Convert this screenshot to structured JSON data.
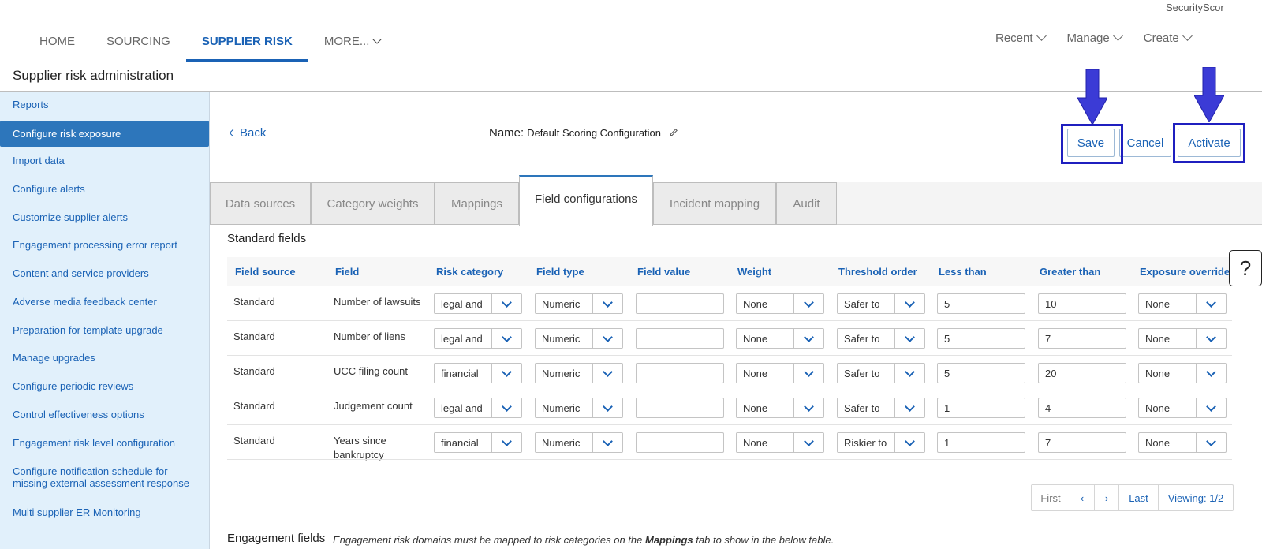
{
  "user": {
    "name": "SecurityScor"
  },
  "topnav": {
    "items": [
      {
        "label": "HOME"
      },
      {
        "label": "SOURCING"
      },
      {
        "label": "SUPPLIER RISK",
        "active": true
      },
      {
        "label": "MORE..."
      }
    ],
    "right": [
      {
        "label": "Recent"
      },
      {
        "label": "Manage"
      },
      {
        "label": "Create"
      }
    ]
  },
  "page": {
    "title": "Supplier risk administration"
  },
  "sidebar": {
    "items": [
      {
        "label": "Reports"
      },
      {
        "label": "Configure risk exposure",
        "active": true
      },
      {
        "label": "Import data"
      },
      {
        "label": "Configure alerts"
      },
      {
        "label": "Customize supplier alerts"
      },
      {
        "label": "Engagement processing error report"
      },
      {
        "label": "Content and service providers"
      },
      {
        "label": "Adverse media feedback center"
      },
      {
        "label": "Preparation for template upgrade"
      },
      {
        "label": "Manage upgrades"
      },
      {
        "label": "Configure periodic reviews"
      },
      {
        "label": "Control effectiveness options"
      },
      {
        "label": "Engagement risk level configuration"
      },
      {
        "label": "Configure notification schedule for missing external assessment response"
      },
      {
        "label": "Multi supplier ER Monitoring"
      }
    ]
  },
  "config": {
    "back_label": "Back",
    "name_label": "Name:",
    "name_value": "Default Scoring Configuration",
    "save_label": "Save",
    "cancel_label": "Cancel",
    "activate_label": "Activate",
    "highlight_color": "#1f1fbf",
    "accent_color": "#1a62b5"
  },
  "tabs": [
    {
      "label": "Data sources"
    },
    {
      "label": "Category weights"
    },
    {
      "label": "Mappings"
    },
    {
      "label": "Field configurations",
      "active": true
    },
    {
      "label": "Incident mapping"
    },
    {
      "label": "Audit"
    }
  ],
  "standard_fields": {
    "title": "Standard fields",
    "columns": [
      "Field source",
      "Field",
      "Risk category",
      "Field type",
      "Field value",
      "Weight",
      "Threshold order",
      "Less than",
      "Greater than",
      "Exposure override"
    ],
    "rows": [
      {
        "source": "Standard",
        "field": "Number of lawsuits",
        "risk_category": "legal and",
        "field_type": "Numeric",
        "field_value": "",
        "weight": "None",
        "threshold": "Safer to",
        "less_than": "5",
        "greater_than": "10",
        "override": "None"
      },
      {
        "source": "Standard",
        "field": "Number of liens",
        "risk_category": "legal and",
        "field_type": "Numeric",
        "field_value": "",
        "weight": "None",
        "threshold": "Safer to",
        "less_than": "5",
        "greater_than": "7",
        "override": "None"
      },
      {
        "source": "Standard",
        "field": "UCC filing count",
        "risk_category": "financial",
        "field_type": "Numeric",
        "field_value": "",
        "weight": "None",
        "threshold": "Safer to",
        "less_than": "5",
        "greater_than": "20",
        "override": "None"
      },
      {
        "source": "Standard",
        "field": "Judgement count",
        "risk_category": "legal and",
        "field_type": "Numeric",
        "field_value": "",
        "weight": "None",
        "threshold": "Safer to",
        "less_than": "1",
        "greater_than": "4",
        "override": "None"
      },
      {
        "source": "Standard",
        "field": "Years since bankruptcy",
        "risk_category": "financial",
        "field_type": "Numeric",
        "field_value": "",
        "weight": "None",
        "threshold": "Riskier to",
        "less_than": "1",
        "greater_than": "7",
        "override": "None"
      }
    ]
  },
  "pager": {
    "first": "First",
    "prev": "‹",
    "next": "›",
    "last": "Last",
    "viewing": "Viewing: 1/2"
  },
  "help": {
    "label": "?"
  },
  "engagement": {
    "title": "Engagement fields",
    "note_before": "Engagement risk domains must be mapped to risk categories on the ",
    "note_bold": "Mappings",
    "note_after": " tab to show in the below table."
  }
}
